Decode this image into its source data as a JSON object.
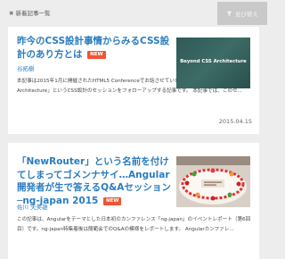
{
  "header": {
    "title": "新着記事一覧",
    "sort_label": "並び替え"
  },
  "articles": [
    {
      "title": "昨今のCSS設計事情からみるCSS設計のあり方とは",
      "badge": "NEW",
      "author": "谷拓樹",
      "excerpt": "本記事は2015年1月に開催されたHTML5 Conferenceでお話させていただいた、「Beyond CSS Architecture」というCSS設計のセッションをフォローアップする記事です。 本記事では、このセ...",
      "date": "2015.04.15",
      "thumbnail_text": "Beyond CSS Architecture"
    },
    {
      "title": "「NewRouter」という名前を付けてしまってゴメンナサイ…Angular開発者が生で答えるQ&Aセッション─ng-japan 2015",
      "badge": "NEW",
      "author": "佐川 夫美雄",
      "excerpt": "この記事は、Angularをテーマとした日本初のカンファレンス「ng-japan」のイベントレポート（第6回目）です。ng-japan特集着後は簡範会でのQ&Aの模様をレポートします。 Angularカンファレ..."
    }
  ],
  "colors": {
    "link": "#2a7cc0",
    "badge": "#ee5634",
    "background": "#ededed"
  }
}
